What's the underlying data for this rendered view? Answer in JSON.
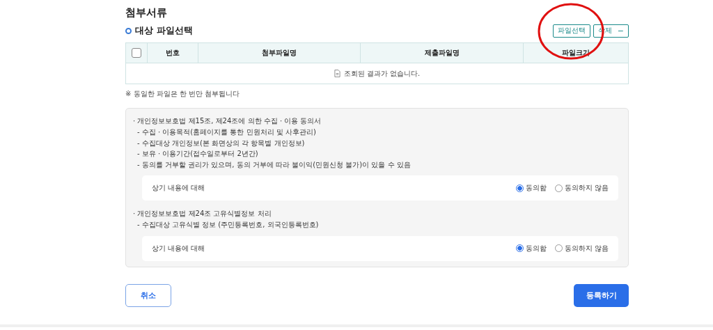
{
  "title": "첨부서류",
  "section": {
    "title": "대상 파일선택"
  },
  "buttons": [
    {
      "label": "파일선택",
      "kind": "select"
    },
    {
      "label": "삭제",
      "kind": "delete",
      "icon": "−"
    }
  ],
  "table": {
    "select_all": {
      "checked": false
    },
    "columns": [
      {
        "label": "번호"
      },
      {
        "label": "첨부파일명"
      },
      {
        "label": "제출파일명"
      },
      {
        "label": "파일크기"
      }
    ],
    "empty_message": "조회된 결과가 없습니다."
  },
  "note": "※ 동일한 파일은 한 번만 첨부됩니다",
  "consents": [
    {
      "heading": "· 개인정보보호법 제15조, 제24조에 의한 수집 · 이용 동의서",
      "items": [
        "- 수집 · 이용목적(홈페이지를 통한 민원처리 및 사후관리)",
        "- 수집대상 개인정보(본 화면상의 각 항목별 개인정보)",
        "- 보유 · 이용기간(접수일로부터 2년간)",
        "- 동의를 거부할 권리가 있으며, 동의  거부에 따라 불이익(민원신청 불가)이 있을 수 있음"
      ],
      "question": "상기 내용에 대해",
      "options": [
        {
          "label": "동의함",
          "selected": true
        },
        {
          "label": "동의하지 않음",
          "selected": false
        }
      ]
    },
    {
      "heading": "· 개인정보보호법 제24조 고유식별정보 처리",
      "items": [
        "- 수집대상 고유식별 정보 (주민등록번호, 외국인등록번호)"
      ],
      "question": "상기 내용에 대해",
      "options": [
        {
          "label": "동의함",
          "selected": true
        },
        {
          "label": "동의하지 않음",
          "selected": false
        }
      ]
    }
  ],
  "actions": [
    {
      "label": "취소",
      "kind": "secondary"
    },
    {
      "label": "등록하기",
      "kind": "primary"
    }
  ],
  "annotation": {
    "kind": "circle"
  }
}
